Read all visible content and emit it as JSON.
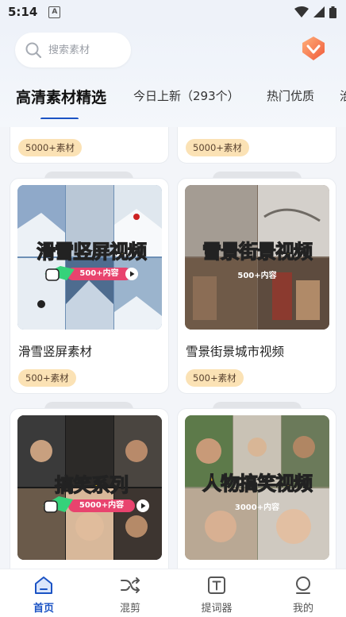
{
  "status_bar": {
    "time": "5:14",
    "notification_letter": "A"
  },
  "search": {
    "placeholder": "搜索素材"
  },
  "tabs": [
    {
      "label": "高清素材精选",
      "active": true
    },
    {
      "label": "今日上新（293个）",
      "active": false
    },
    {
      "label": "热门优质",
      "active": false
    },
    {
      "label": "治",
      "active": false
    }
  ],
  "cards_top_partial": [
    {
      "badge": "5000+素材"
    },
    {
      "badge": "5000+素材"
    }
  ],
  "cards": [
    {
      "thumb_headline": "滑雪竖屏视频",
      "thumb_pill": "500+内容",
      "title": "滑雪竖屏素材",
      "badge": "500+素材"
    },
    {
      "thumb_headline": "雪景街景视频",
      "thumb_pill": "500+内容",
      "title": "雪景街景城市视频",
      "badge": "500+素材"
    },
    {
      "thumb_headline": "搞笑系列",
      "thumb_pill": "5000+内容",
      "title": "",
      "badge": ""
    },
    {
      "thumb_headline": "人物搞笑视频",
      "thumb_pill": "3000+内容",
      "title": "",
      "badge": ""
    }
  ],
  "bottom_nav": [
    {
      "label": "首页",
      "icon": "home-icon",
      "active": true
    },
    {
      "label": "混剪",
      "icon": "shuffle-icon",
      "active": false
    },
    {
      "label": "提词器",
      "icon": "teleprompter-icon",
      "active": false
    },
    {
      "label": "我的",
      "icon": "profile-icon",
      "active": false
    }
  ],
  "colors": {
    "accent": "#1b53c4",
    "badge_bg": "#fbe2b5",
    "headline_yellow": "#ffd21f",
    "headline_green": "#35d27a",
    "pill_pink": "#e8436e"
  }
}
